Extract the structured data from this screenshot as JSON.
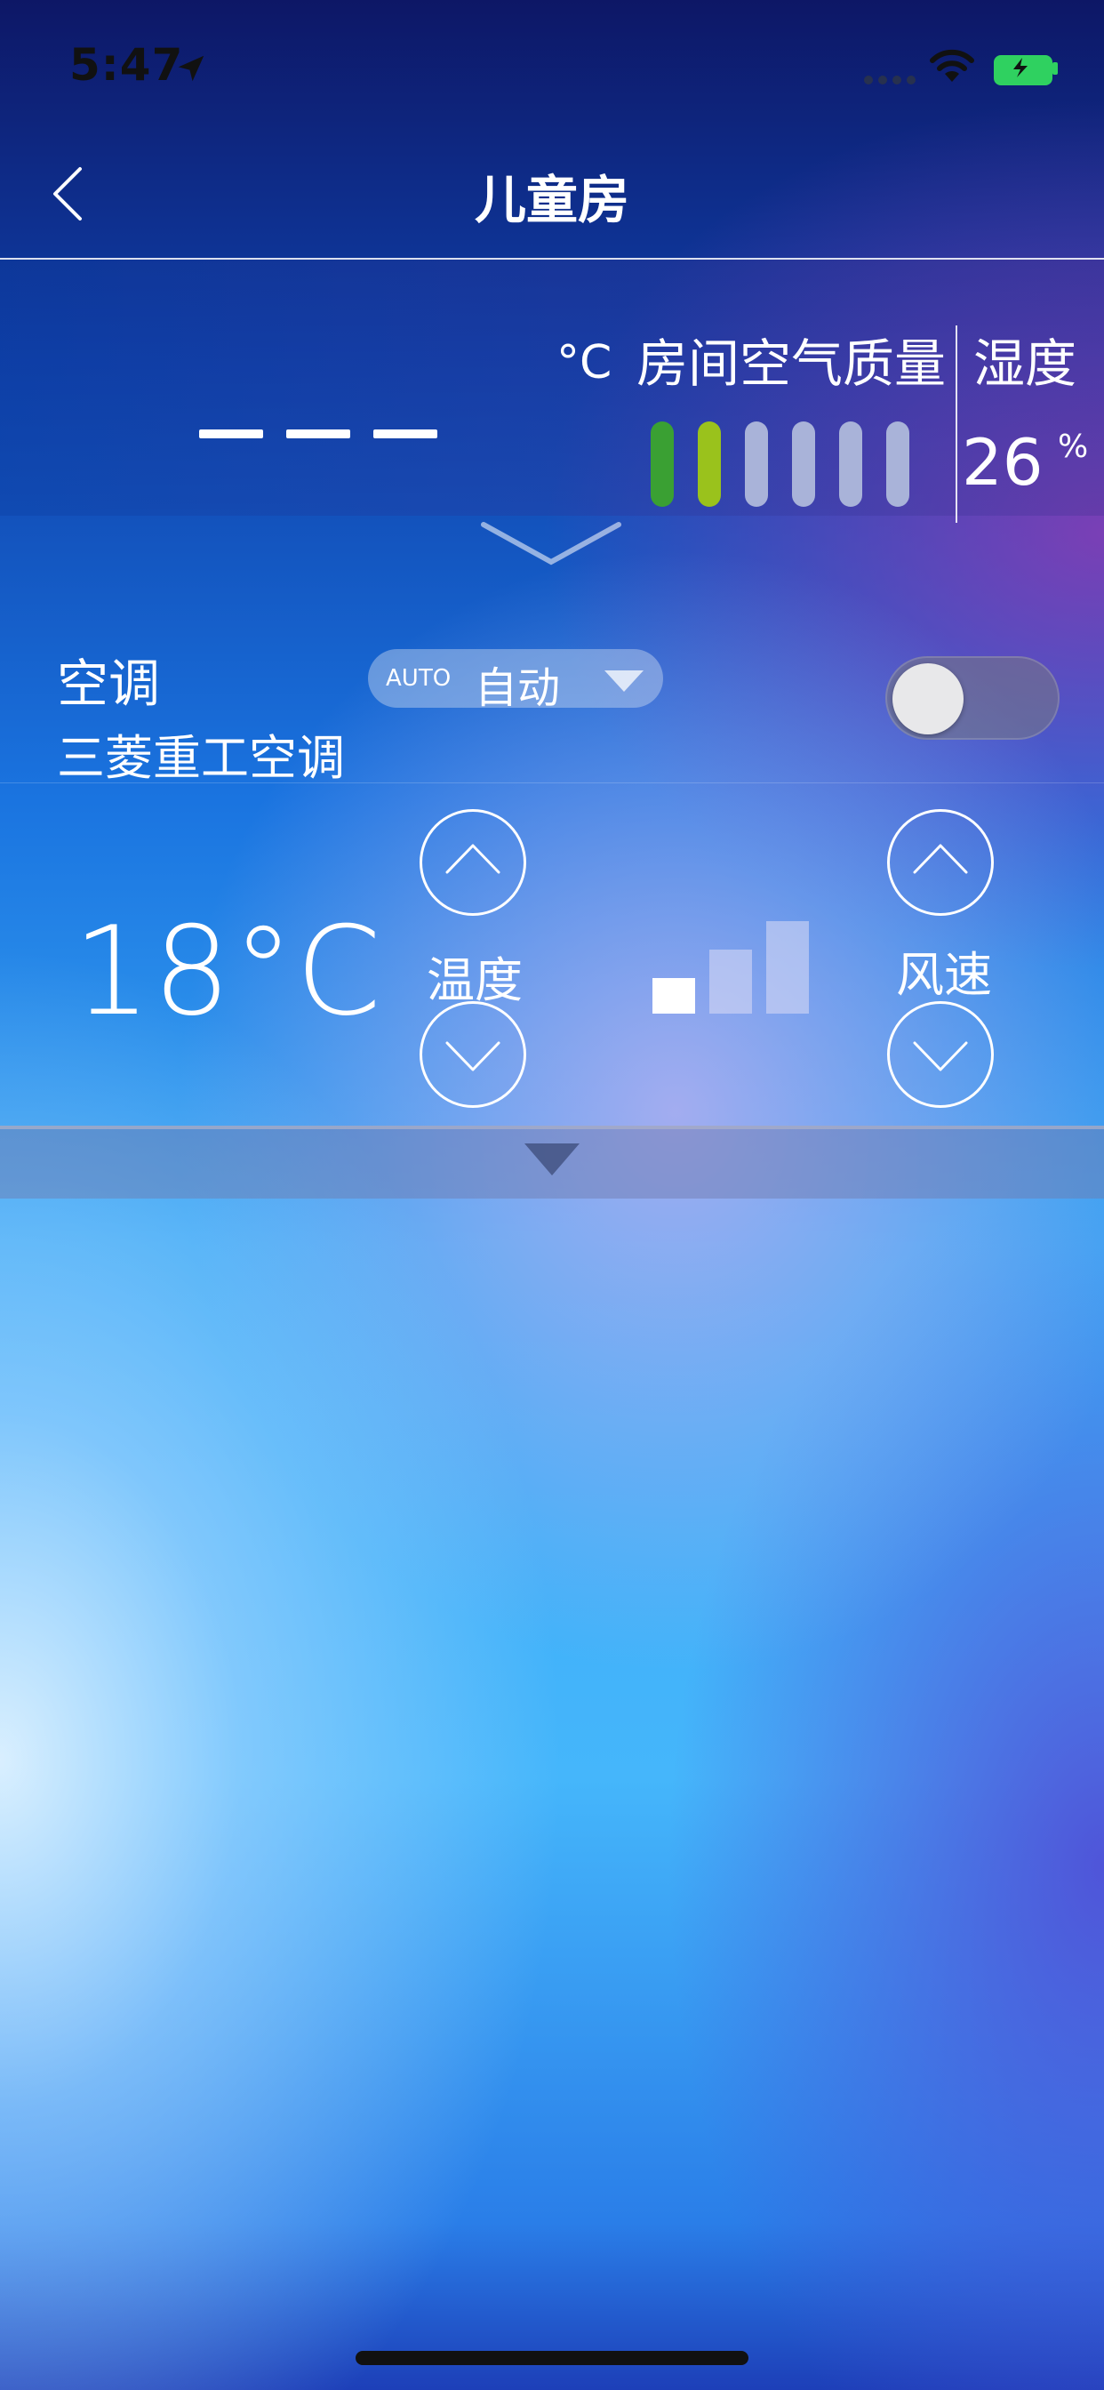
{
  "status_bar": {
    "time": "5:47",
    "icons": [
      "location-arrow-icon",
      "cellular-dots-icon",
      "wifi-icon",
      "battery-charging-icon"
    ],
    "battery_color": "#2fd160"
  },
  "nav": {
    "title": "儿童房",
    "back_icon": "chevron-left-icon"
  },
  "sensors": {
    "room_temperature": "— — —",
    "temperature_unit": "°C",
    "air_quality_label": "房间空气质量",
    "air_quality_level": 2,
    "air_quality_total": 6,
    "air_quality_colors": [
      "#3aa033",
      "#9ac21c",
      "#a9b3d9",
      "#a9b3d9",
      "#a9b3d9",
      "#a9b3d9"
    ],
    "humidity_label": "湿度",
    "humidity_value": "26",
    "humidity_unit": "%"
  },
  "ac": {
    "title": "空调",
    "device_name": "三菱重工空调",
    "mode_badge": "AUTO",
    "mode_label": "自动",
    "power_on": false,
    "set_temperature": "18°C",
    "temperature_label": "温度",
    "fan_label": "风速",
    "fan_speed_level": 1,
    "fan_speed_total": 3
  }
}
